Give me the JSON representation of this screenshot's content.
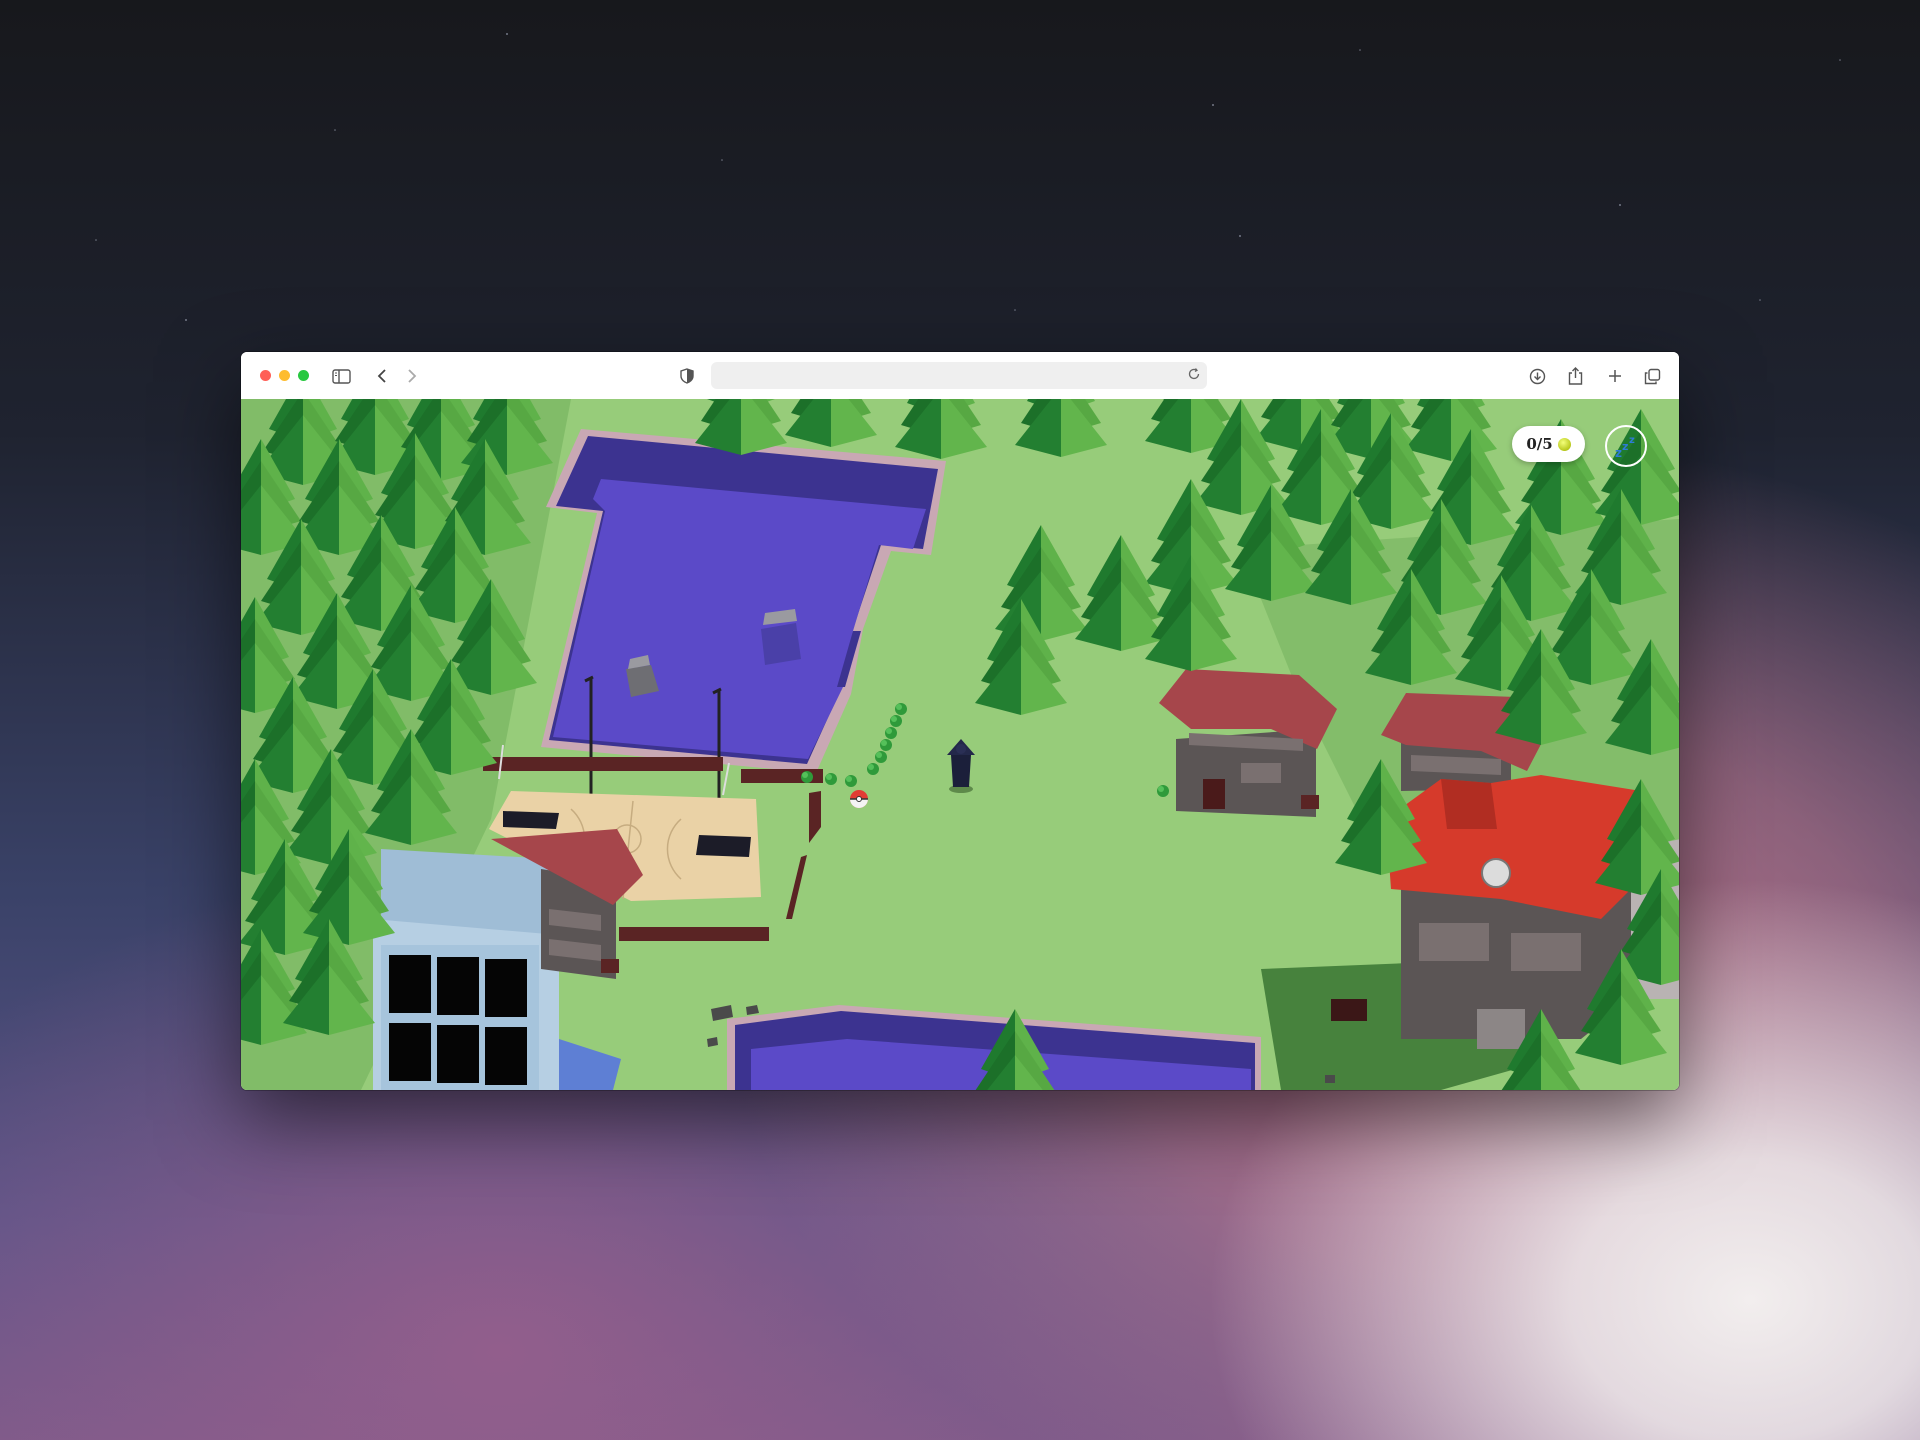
{
  "browser": {
    "url": "",
    "traffic_lights": {
      "close": "#ff5f57",
      "minimize": "#febc2e",
      "zoom": "#28c840"
    },
    "icons": [
      "sidebar-icon",
      "back-chevron-icon",
      "forward-chevron-icon",
      "shield-icon",
      "reload-icon",
      "download-icon",
      "share-icon",
      "new-tab-plus-icon",
      "tab-overview-icon"
    ]
  },
  "game": {
    "hud": {
      "collected": "0/5",
      "collectible_icon": "tennis-ball-icon",
      "sleep_button_icon": "zzz-sleep-icon"
    },
    "colors": {
      "grass": "#97cc7a",
      "tree_dark": "#1f7a2e",
      "tree_light": "#5fb24a",
      "pool_water": "#5b4ac8",
      "pool_wall": "#3c3390",
      "pool_rim": "#c9a8b4",
      "roof_red": "#d63a2b",
      "roof_brown": "#a6464b",
      "building_grey": "#5b5555",
      "glass_building": "#9fbdd6",
      "court_wood": "#ead2a6",
      "fence": "#5a2424"
    }
  }
}
